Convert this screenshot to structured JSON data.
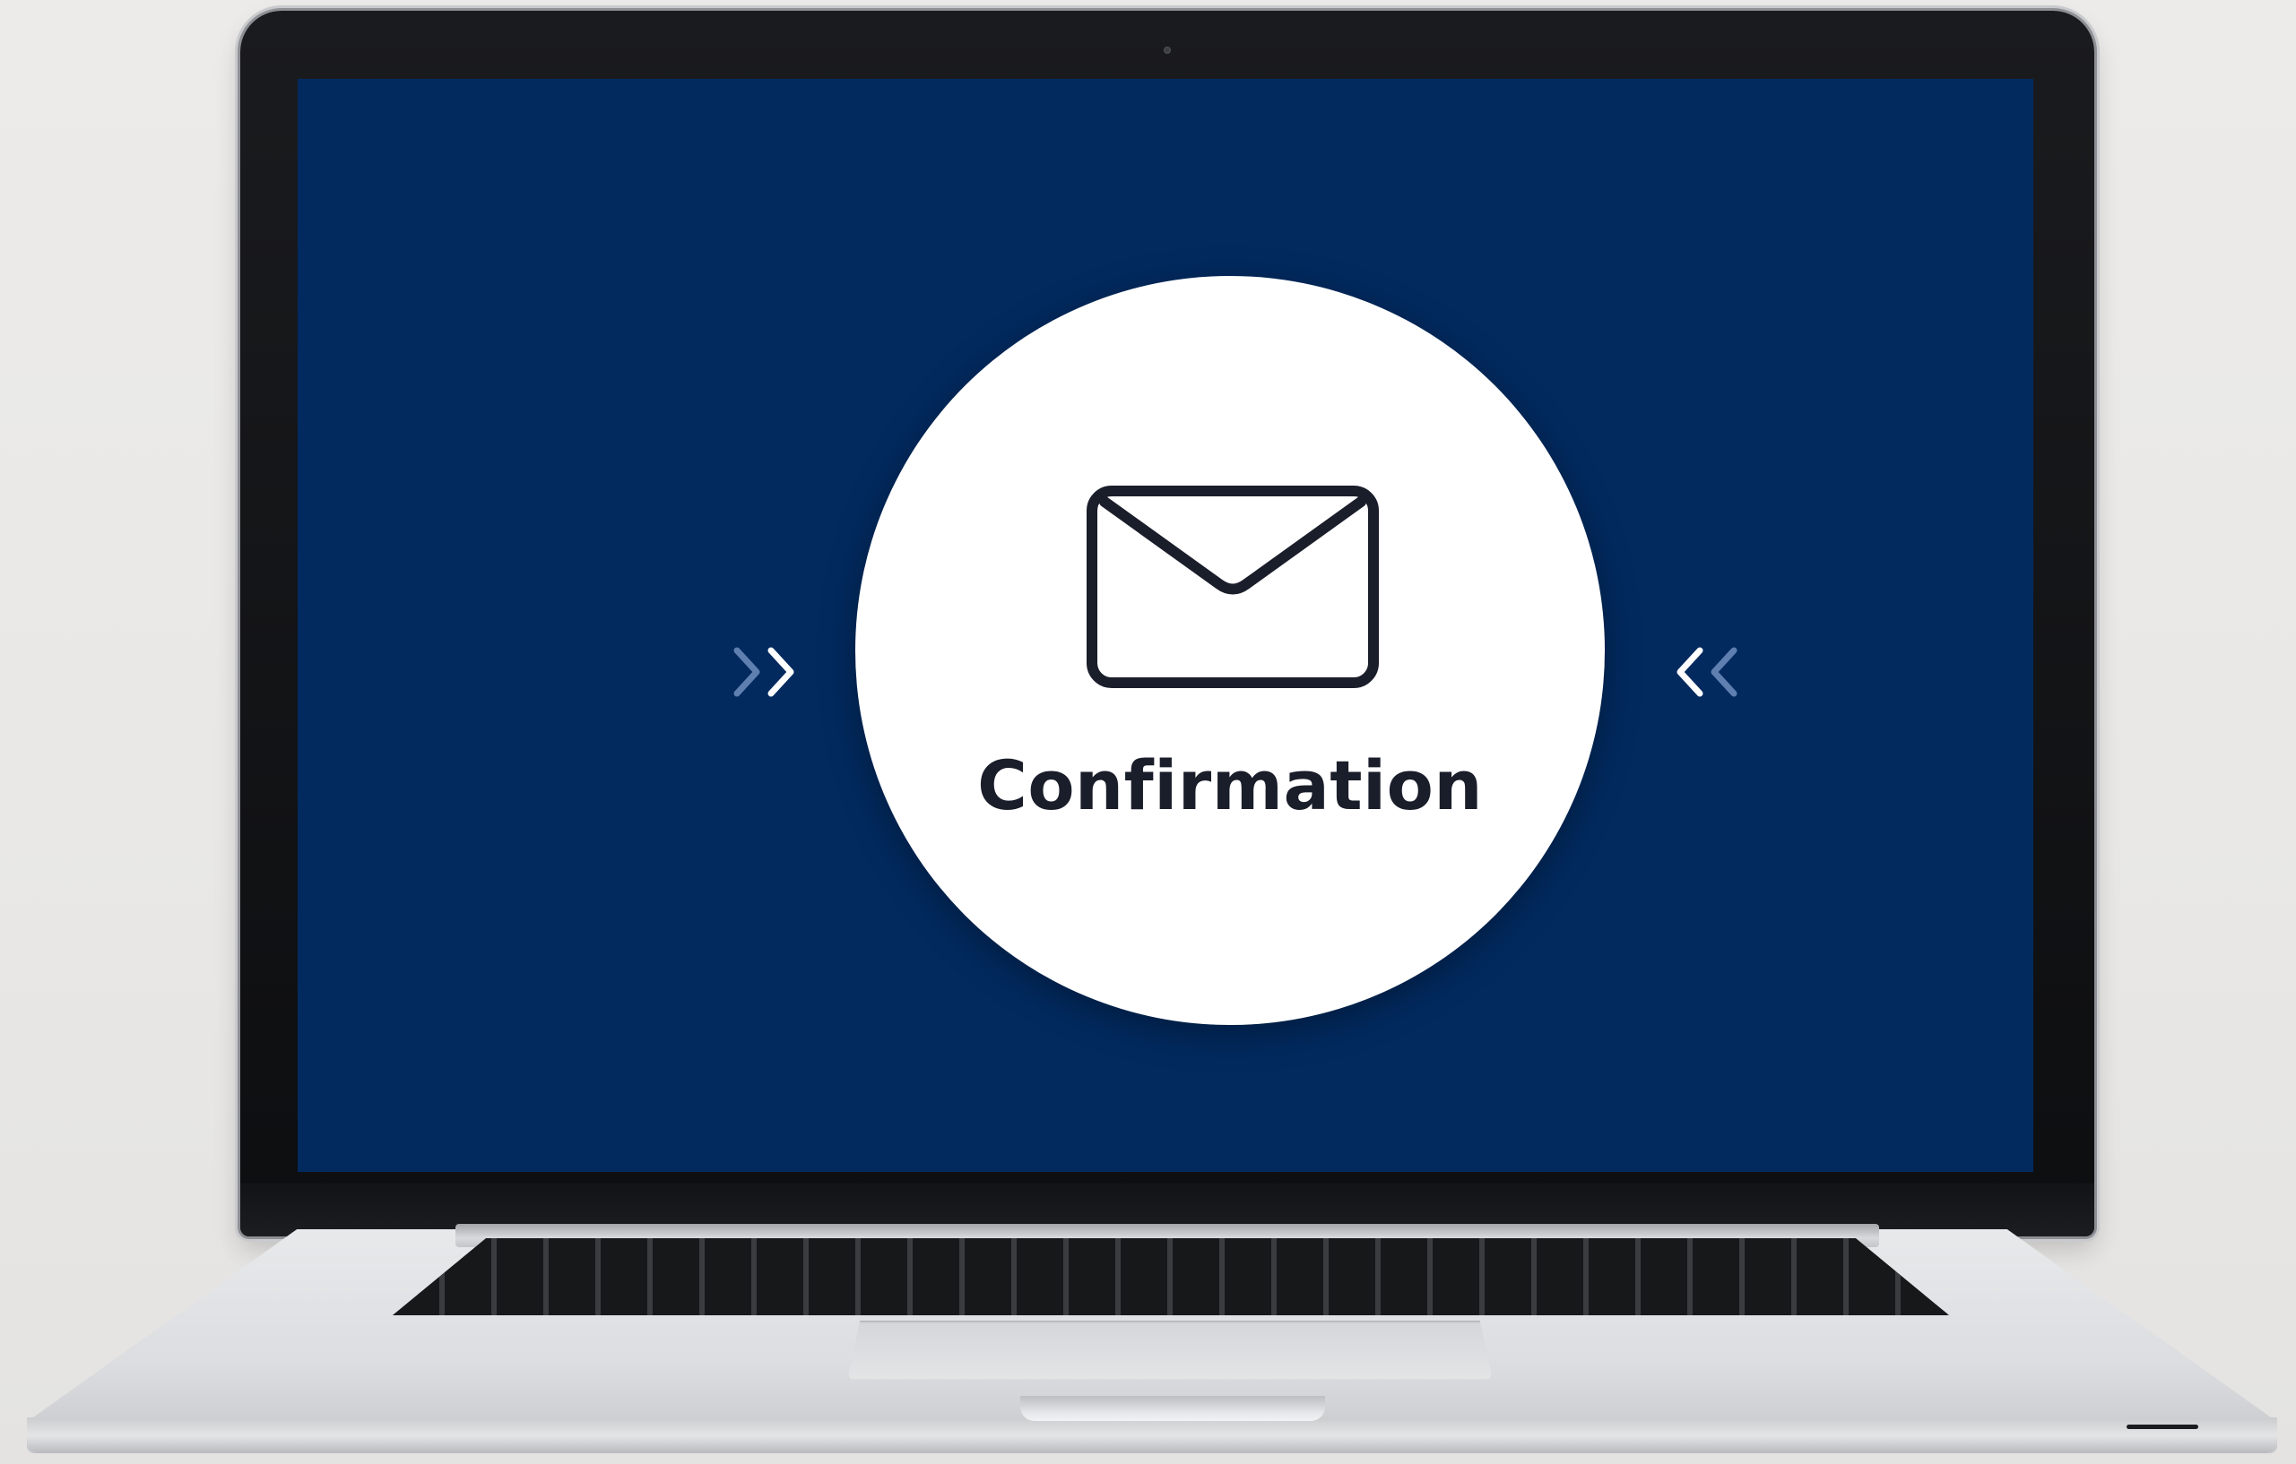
{
  "screen": {
    "background_color": "#022a5f",
    "card": {
      "icon": "envelope-icon",
      "label": "Confirmation",
      "label_color": "#1a1d2a",
      "background_color": "#ffffff"
    },
    "left_indicator": {
      "icon": "double-chevron-right-icon",
      "colors": [
        "#5f7fb0",
        "#ffffff"
      ]
    },
    "right_indicator": {
      "icon": "double-chevron-left-icon",
      "colors": [
        "#ffffff",
        "#5f7fb0"
      ]
    }
  }
}
